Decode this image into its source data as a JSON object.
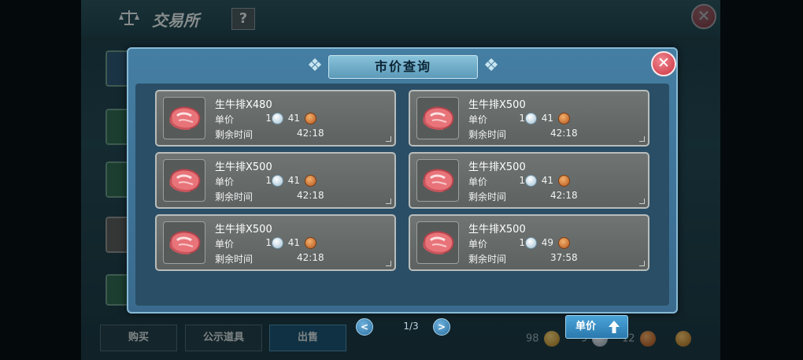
{
  "background": {
    "title": "交易所",
    "help_label": "?",
    "close_label": "✕",
    "tabs": [
      "购买",
      "公示道具",
      "出售"
    ],
    "currency": [
      "98",
      "9",
      "12"
    ]
  },
  "modal": {
    "title": "市价查询",
    "close_label": "✕",
    "price_label": "单价",
    "time_label": "剩余时间",
    "listings": [
      {
        "name": "生牛排X480",
        "gold": "1",
        "copper": "41",
        "time": "42:18"
      },
      {
        "name": "生牛排X500",
        "gold": "1",
        "copper": "41",
        "time": "42:18"
      },
      {
        "name": "生牛排X500",
        "gold": "1",
        "copper": "41",
        "time": "42:18"
      },
      {
        "name": "生牛排X500",
        "gold": "1",
        "copper": "41",
        "time": "42:18"
      },
      {
        "name": "生牛排X500",
        "gold": "1",
        "copper": "41",
        "time": "42:18"
      },
      {
        "name": "生牛排X500",
        "gold": "1",
        "copper": "49",
        "time": "37:58"
      }
    ],
    "pagination": {
      "prev": "<",
      "next": ">",
      "indicator": "1/3"
    },
    "sort_button": "单价"
  }
}
